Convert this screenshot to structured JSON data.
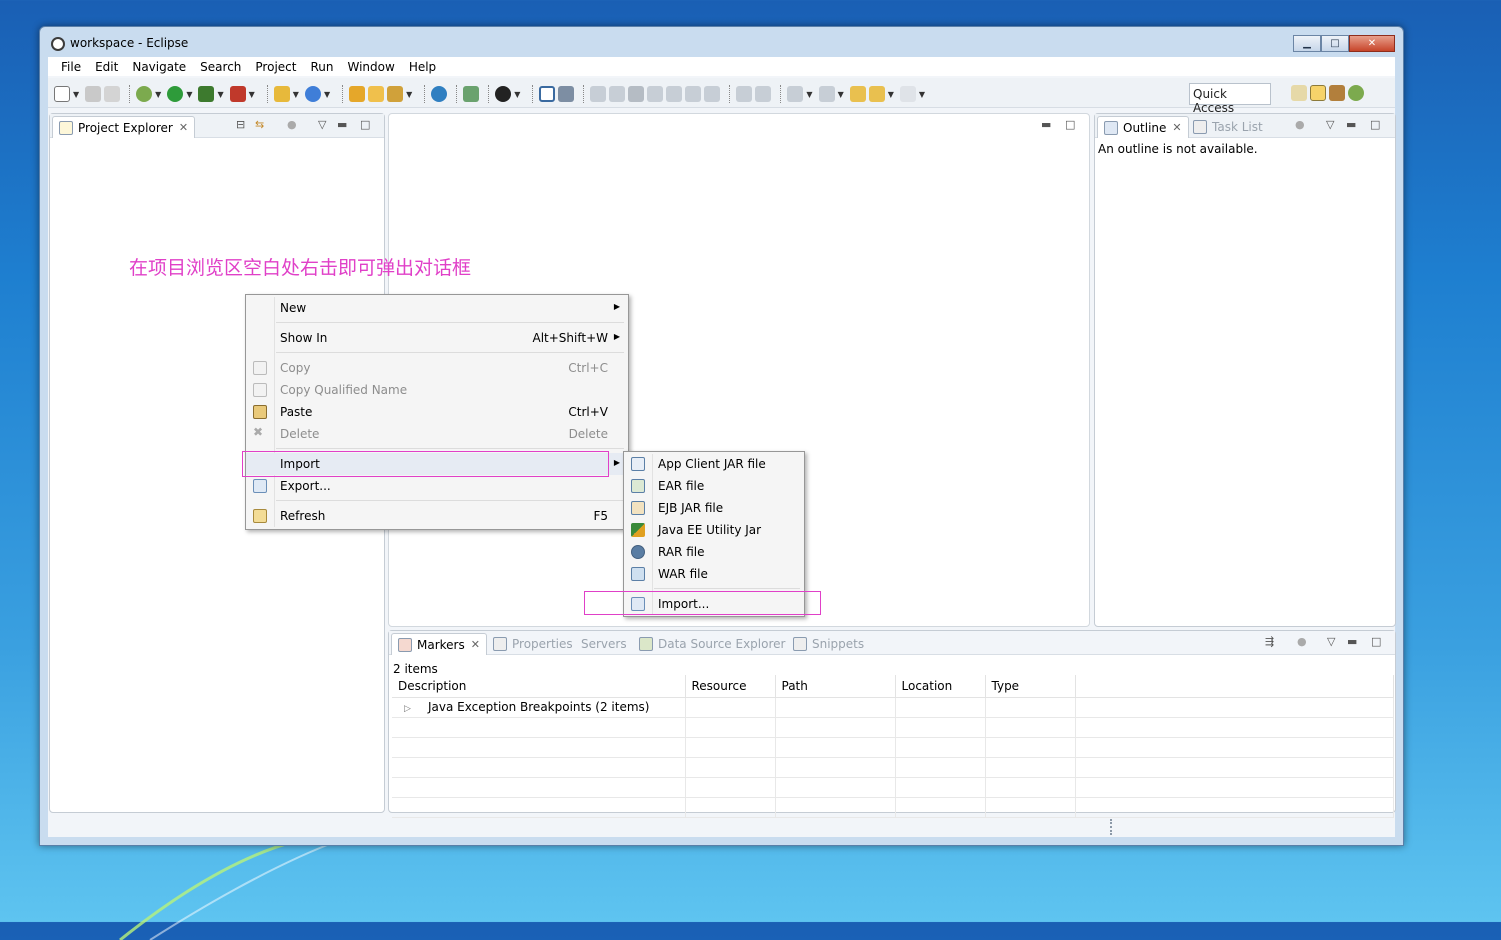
{
  "window": {
    "title": "workspace - Eclipse",
    "controls": [
      "minimize-icon",
      "maximize-icon",
      "close-icon"
    ]
  },
  "menubar": [
    "File",
    "Edit",
    "Navigate",
    "Search",
    "Project",
    "Run",
    "Window",
    "Help"
  ],
  "toolbar": {
    "quick_access": "Quick Access"
  },
  "project_explorer": {
    "tab_label": "Project Explorer"
  },
  "outline": {
    "tab_label": "Outline",
    "task_list_label": "Task List",
    "message": "An outline is not available."
  },
  "annotation": "在项目浏览区空白处右击即可弹出对话框",
  "context_menu": {
    "items": [
      {
        "label": "New",
        "shortcut": "",
        "submenu": true,
        "enabled": true
      },
      {
        "label": "Show In",
        "shortcut": "Alt+Shift+W",
        "submenu": true,
        "enabled": true
      },
      {
        "label": "Copy",
        "shortcut": "Ctrl+C",
        "enabled": false
      },
      {
        "label": "Copy Qualified Name",
        "shortcut": "",
        "enabled": false
      },
      {
        "label": "Paste",
        "shortcut": "Ctrl+V",
        "enabled": true
      },
      {
        "label": "Delete",
        "shortcut": "Delete",
        "enabled": false
      },
      {
        "label": "Import",
        "shortcut": "",
        "submenu": true,
        "enabled": true
      },
      {
        "label": "Export...",
        "shortcut": "",
        "enabled": true
      },
      {
        "label": "Refresh",
        "shortcut": "F5",
        "enabled": true
      }
    ]
  },
  "import_submenu": {
    "items": [
      "App Client JAR file",
      "EAR file",
      "EJB JAR file",
      "Java EE Utility Jar",
      "RAR file",
      "WAR file",
      "Import..."
    ]
  },
  "bottom_panel": {
    "tabs": [
      "Markers",
      "Properties",
      "Servers",
      "Data Source Explorer",
      "Snippets"
    ],
    "items_count": "2 items",
    "columns": [
      "Description",
      "Resource",
      "Path",
      "Location",
      "Type"
    ],
    "rows": [
      {
        "description": "Java Exception Breakpoints (2 items)",
        "resource": "",
        "path": "",
        "location": "",
        "type": ""
      }
    ]
  },
  "colors": {
    "annotation": "#e040c8",
    "highlight_box": "#e040c8",
    "desktop": "#1e7fd0"
  }
}
